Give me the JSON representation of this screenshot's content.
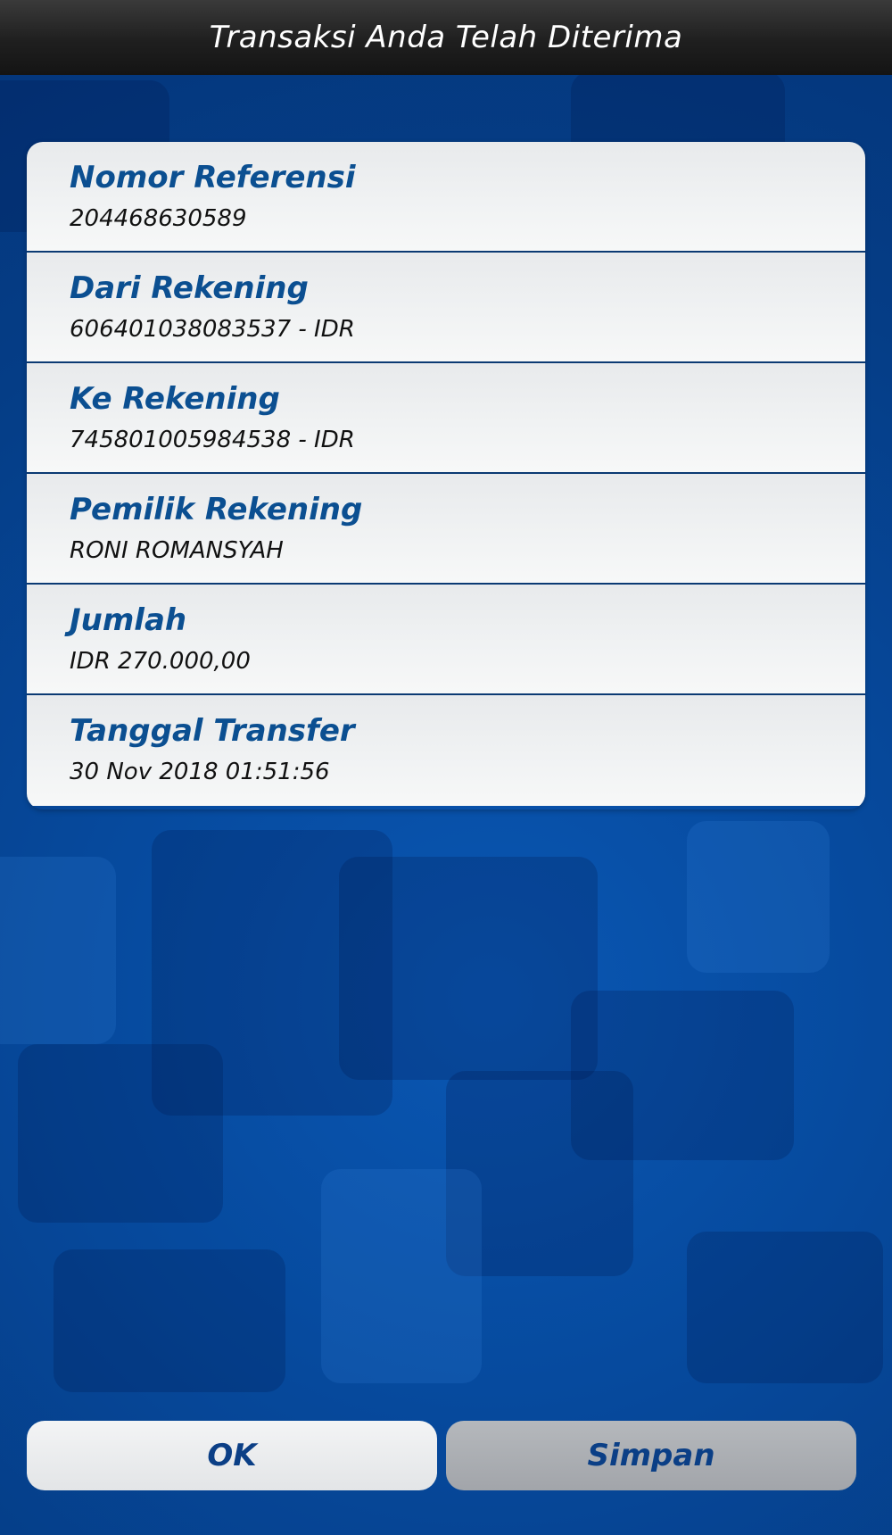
{
  "header": {
    "title": "Transaksi Anda Telah Diterima"
  },
  "details": [
    {
      "label": "Nomor Referensi",
      "value": "204468630589"
    },
    {
      "label": "Dari Rekening",
      "value": "606401038083537 - IDR"
    },
    {
      "label": "Ke Rekening",
      "value": "745801005984538 - IDR"
    },
    {
      "label": "Pemilik Rekening",
      "value": "RONI ROMANSYAH"
    },
    {
      "label": "Jumlah",
      "value": "IDR 270.000,00"
    },
    {
      "label": "Tanggal Transfer",
      "value": "30 Nov 2018 01:51:56"
    }
  ],
  "buttons": {
    "ok": "OK",
    "save": "Simpan"
  },
  "colors": {
    "header_bg": "#1f1f1f",
    "background": "#063f8f",
    "label": "#0b4f91",
    "divider": "#0b3a73"
  }
}
